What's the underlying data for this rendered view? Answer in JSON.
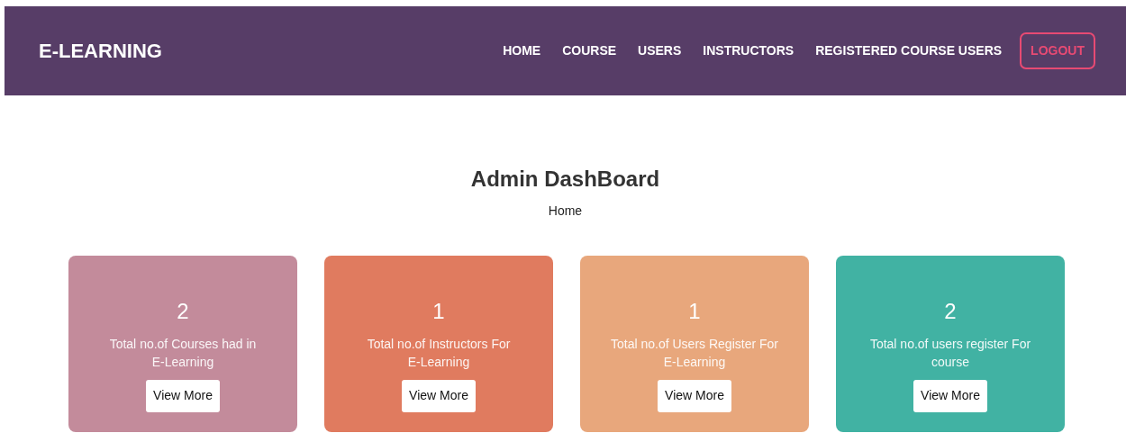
{
  "navbar": {
    "brand": "E-LEARNING",
    "links": [
      "HOME",
      "COURSE",
      "USERS",
      "INSTRUCTORS",
      "REGISTERED COURSE USERS"
    ],
    "logout_button": "LOGOUT"
  },
  "heading": "Admin DashBoard",
  "breadcrumb": "Home",
  "stat_cards": [
    {
      "count": "2",
      "description": "Total no.of Courses had in E-Learning",
      "button": "View More",
      "color": "#c38b9b"
    },
    {
      "count": "1",
      "description": "Total no.of Instructors For E-Learning",
      "button": "View More",
      "color": "#e07b5f"
    },
    {
      "count": "1",
      "description": "Total no.of Users Register For E-Learning",
      "button": "View More",
      "color": "#e8a77c"
    },
    {
      "count": "2",
      "description": "Total no.of users register For course",
      "button": "View More",
      "color": "#41b2a3"
    }
  ]
}
